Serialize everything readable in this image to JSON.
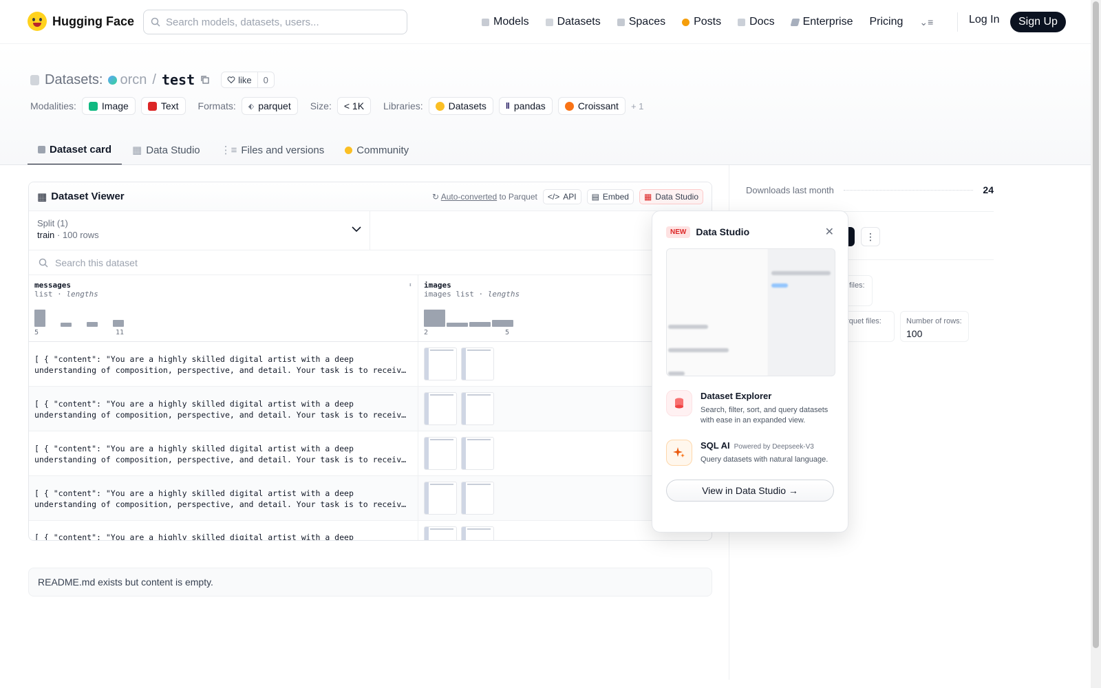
{
  "nav": {
    "brand": "Hugging Face",
    "search_placeholder": "Search models, datasets, users...",
    "items": [
      "Models",
      "Datasets",
      "Spaces",
      "Posts",
      "Docs",
      "Enterprise",
      "Pricing"
    ],
    "login": "Log In",
    "signup": "Sign Up"
  },
  "repo": {
    "section": "Datasets:",
    "owner": "orcn",
    "slash": "/",
    "name": "test",
    "like_label": "like",
    "like_count": "0"
  },
  "tags": {
    "modalities_label": "Modalities:",
    "modalities": [
      "Image",
      "Text"
    ],
    "formats_label": "Formats:",
    "format": "parquet",
    "size_label": "Size:",
    "size": "< 1K",
    "libraries_label": "Libraries:",
    "libraries": [
      "Datasets",
      "pandas",
      "Croissant"
    ],
    "more": "+ 1"
  },
  "tabs": [
    "Dataset card",
    "Data Studio",
    "Files and versions",
    "Community"
  ],
  "viewer": {
    "title": "Dataset Viewer",
    "auto_converted": "Auto-converted",
    "to_parquet": "to Parquet",
    "api": "API",
    "embed": "Embed",
    "data_studio": "Data Studio",
    "split_label": "Split (1)",
    "split_name": "train",
    "split_rows": "100 rows",
    "search_placeholder": "Search this dataset",
    "col1": {
      "name": "messages",
      "type": "list",
      "stat": "lengths",
      "min": "5",
      "max": "11"
    },
    "col2": {
      "name": "images",
      "type": "images list",
      "stat": "lengths",
      "min": "2",
      "max": "5"
    },
    "row_line1": "[ { \"content\": \"You are a highly skilled digital artist with a deep",
    "row_line2": "understanding of composition, perspective, and detail. Your task is to receiv…"
  },
  "readme": "README.md exists but content is empty.",
  "sidebar": {
    "downloads_label": "Downloads last month",
    "downloads": "24",
    "files_label": "files:",
    "parquet_label": "arquet files:",
    "rows_label": "Number of rows:",
    "rows": "100"
  },
  "popup": {
    "badge": "NEW",
    "title": "Data Studio",
    "f1_title": "Dataset Explorer",
    "f1_desc": "Search, filter, sort, and query datasets with ease in an expanded view.",
    "f2_title": "SQL AI",
    "f2_powered": "Powered by Deepseek-V3",
    "f2_desc": "Query datasets with natural language.",
    "cta": "View in Data Studio →"
  }
}
